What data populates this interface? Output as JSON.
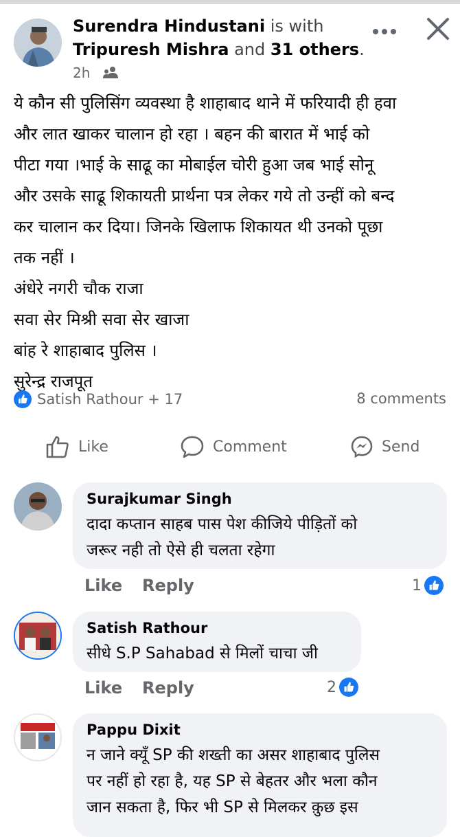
{
  "header": {
    "author": "Surendra Hindustani",
    "is_with": "is with",
    "tagged": "Tripuresh Mishra",
    "and": "and",
    "others": "31 others",
    "time": "2h",
    "audience_icon": "friends-icon",
    "more_icon": "more-icon",
    "close_icon": "close-icon"
  },
  "post": {
    "lines": [
      "ये कौन सी पुलिसिंग व्यवस्था है शाहाबाद थाने में फरियादी ही हवा",
      "और लात खाकर चालान हो रहा । बहन की बारात में भाई को",
      "पीटा गया ।भाई के साढू का मोबाईल चोरी हुआ जब भाई सोनू",
      "और उसके साढू शिकायती प्रार्थना पत्र लेकर गये तो उन्हीं को बन्द",
      "कर चालान कर दिया। जिनके खिलाफ शिकायत थी उनको पूछा",
      "तक नहीं ।",
      "अंधेरे नगरी चौक राजा",
      "सवा सेर मिश्री सवा सेर खाजा",
      "बांह रे शाहाबाद पुलिस ।",
      "सुरेन्द्र राजपूत"
    ]
  },
  "reactions": {
    "summary": "Satish Rathour + 17",
    "comments": "8 comments"
  },
  "actions": {
    "like": "Like",
    "comment": "Comment",
    "send": "Send"
  },
  "comments": [
    {
      "name": "Surajkumar Singh",
      "lines": [
        "दादा कप्तान साहब पास पेश कीजिये पीड़ितों को",
        "जरूर नही तो ऐसे ही चलता रहेगा"
      ],
      "like": "Like",
      "reply": "Reply",
      "count": "1"
    },
    {
      "name": "Satish Rathour",
      "lines": [
        "सीधे S.P Sahabad से मिलों चाचा जी"
      ],
      "like": "Like",
      "reply": "Reply",
      "count": "2"
    },
    {
      "name": "Pappu Dixit",
      "lines": [
        "न जाने क्यूँ SP की शख्ती का असर शाहाबाद पुलिस",
        "पर नहीं हो रहा है, यह SP से बेहतर और भला कौन",
        "जान सकता है, फिर भी SP से मिलकर क़ुछ इस"
      ]
    }
  ],
  "colors": {
    "accent": "#1877f2",
    "bubble": "#f0f2f5",
    "muted": "#65676b"
  }
}
